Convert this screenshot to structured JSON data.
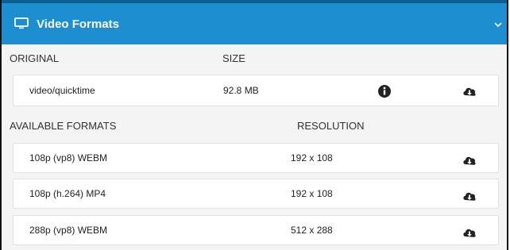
{
  "panel": {
    "title": "Video Formats",
    "icon": "monitor-icon",
    "collapse_icon": "chevron-down-icon",
    "accent_color": "#1d8fd0"
  },
  "original": {
    "headers": {
      "name": "ORIGINAL",
      "size": "SIZE"
    },
    "file": {
      "type": "video/quicktime",
      "size": "92.8 MB"
    }
  },
  "available": {
    "headers": {
      "name": "AVAILABLE FORMATS",
      "resolution": "RESOLUTION"
    },
    "formats": [
      {
        "name": "108p (vp8) WEBM",
        "resolution": "192 x 108"
      },
      {
        "name": "108p (h.264) MP4",
        "resolution": "192 x 108"
      },
      {
        "name": "288p (vp8) WEBM",
        "resolution": "512 x 288"
      }
    ]
  }
}
